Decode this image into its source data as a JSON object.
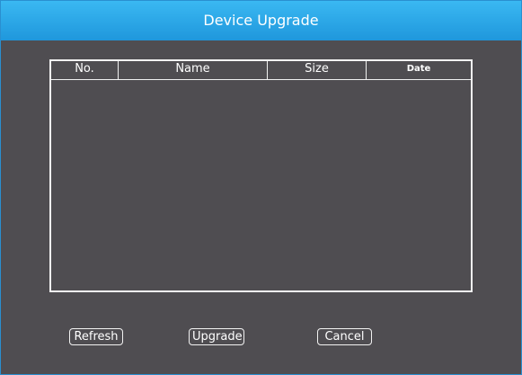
{
  "window": {
    "title": "Device Upgrade"
  },
  "table": {
    "columns": [
      "No.",
      "Name",
      "Size",
      "Date"
    ],
    "rows": []
  },
  "buttons": {
    "refresh_label": "Refresh",
    "upgrade_label": "Upgrade",
    "cancel_label": "Cancel"
  },
  "colors": {
    "title_bar": "#1f97dc",
    "background": "#4f4d51",
    "border": "#f2f2f2",
    "text": "#ffffff"
  }
}
